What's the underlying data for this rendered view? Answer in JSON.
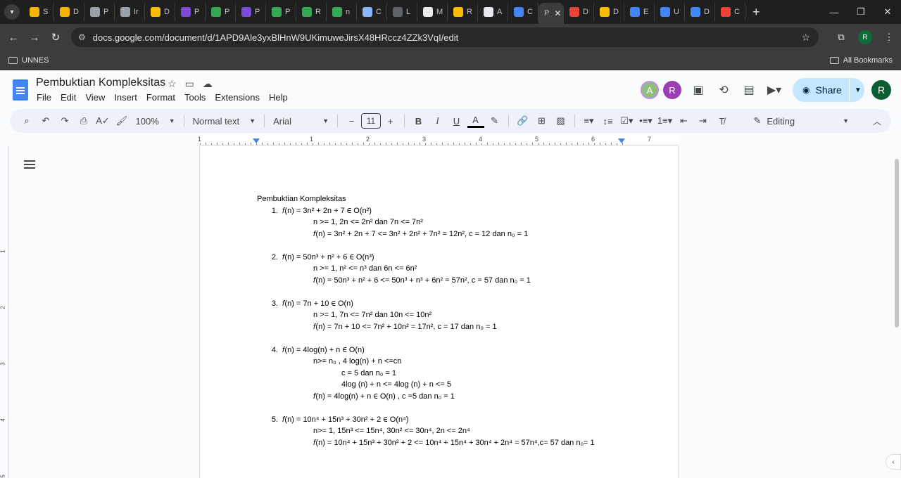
{
  "browser": {
    "tabs": [
      {
        "label": "S",
        "color": "#f4b400"
      },
      {
        "label": "D",
        "color": "#f4b400"
      },
      {
        "label": "P",
        "color": "#9aa0a6"
      },
      {
        "label": "Ir",
        "color": "#9aa0a6"
      },
      {
        "label": "D",
        "color": "#fbbc04"
      },
      {
        "label": "P",
        "color": "#7b4ad6"
      },
      {
        "label": "P",
        "color": "#34a853"
      },
      {
        "label": "P",
        "color": "#7b4ad6"
      },
      {
        "label": "P",
        "color": "#34a853"
      },
      {
        "label": "R",
        "color": "#34a853"
      },
      {
        "label": "n",
        "color": "#34a853"
      },
      {
        "label": "C",
        "color": "#8ab4f8"
      },
      {
        "label": "L",
        "color": "#5f6368"
      },
      {
        "label": "M",
        "color": "#e8eaed"
      },
      {
        "label": "R",
        "color": "#fbbc04"
      },
      {
        "label": "A",
        "color": "#e8eaed"
      },
      {
        "label": "C",
        "color": "#4285f4"
      },
      {
        "label": "P",
        "color": "#3c3c3c",
        "active": true
      },
      {
        "label": "D",
        "color": "#ea4335"
      },
      {
        "label": "D",
        "color": "#fbbc04"
      },
      {
        "label": "E",
        "color": "#4285f4"
      },
      {
        "label": "U",
        "color": "#4285f4"
      },
      {
        "label": "D",
        "color": "#4285f4"
      },
      {
        "label": "C",
        "color": "#ea4335"
      }
    ],
    "url": "docs.google.com/document/d/1APD9Ale3yxBlHnW9UKimuweJirsX48HRccz4ZZk3VqI/edit",
    "bookmark_folder": "UNNES",
    "all_bookmarks": "All Bookmarks",
    "profile_initial": "R"
  },
  "docs": {
    "title": "Pembuktian Kompleksitas",
    "menu": [
      "File",
      "Edit",
      "View",
      "Insert",
      "Format",
      "Tools",
      "Extensions",
      "Help"
    ],
    "avatars": [
      "A",
      "R"
    ],
    "share_label": "Share",
    "user_initial": "R",
    "toolbar": {
      "zoom": "100%",
      "style": "Normal text",
      "font": "Arial",
      "font_size": "11",
      "mode": "Editing"
    },
    "ruler_numbers": [
      "1",
      "1",
      "2",
      "3",
      "4",
      "5",
      "6",
      "7"
    ],
    "vruler_numbers": [
      "1",
      "2",
      "3",
      "4",
      "5"
    ]
  },
  "document": {
    "heading": "Pembuktian Kompleksitas",
    "items": [
      {
        "num": "1.",
        "main": "𝑓(n) = 3n² + 2n + 7 ∈ O(n²)",
        "lines": [
          {
            "indent": 1,
            "text": "n >= 1, 2n <= 2n² dan 7n <= 7n²"
          },
          {
            "indent": 1,
            "text": "𝑓(n) = 3n² + 2n + 7 <= 3n² + 2n² + 7n² = 12n², c = 12 dan n₀ = 1"
          }
        ]
      },
      {
        "num": "2.",
        "main": "𝑓(n) = 50n³ + n² + 6 ∈ O(n³)",
        "lines": [
          {
            "indent": 1,
            "text": "n >= 1, n² <= n³ dan 6n <= 6n²"
          },
          {
            "indent": 1,
            "text": "𝑓(n) = 50n³ + n² + 6 <= 50n³ + n³ + 6n² = 57n², c = 57 dan n₀ = 1"
          }
        ]
      },
      {
        "num": "3.",
        "main": "𝑓(n) = 7n + 10 ∈ O(n)",
        "lines": [
          {
            "indent": 1,
            "text": "n >= 1, 7n <= 7n² dan 10n <= 10n²"
          },
          {
            "indent": 1,
            "text": "𝑓(n) = 7n + 10 <= 7n² + 10n² = 17n², c = 17 dan n₀ = 1"
          }
        ]
      },
      {
        "num": "4.",
        "main": "𝑓(n) = 4log(n) + n ∈ O(n)",
        "lines": [
          {
            "indent": 1,
            "text": "n>= n₀ , 4 log(n) + n <=cn"
          },
          {
            "indent": 2,
            "text": "c = 5 dan n₀ = 1"
          },
          {
            "indent": 2,
            "text": "4log (n) + n <= 4log (n) + n <= 5"
          },
          {
            "indent": 1,
            "text": "𝑓(n) = 4log(n) + n ∈ O(n) , c =5 dan n₀ = 1"
          }
        ]
      },
      {
        "num": "5.",
        "main": "𝑓(n) = 10n⁴ + 15n³ + 30n² + 2 ∈ O(n⁴)",
        "lines": [
          {
            "indent": 1,
            "text": "n>= 1, 15n³ <= 15n⁴, 30n² <= 30n⁴, 2n <= 2n⁴"
          },
          {
            "indent": 1,
            "text": "𝑓(n) = 10n⁴ + 15n³ + 30n² + 2 <= 10n⁴ + 15n⁴ + 30n⁴ + 2n⁴ = 57n⁴,c= 57 dan n₀= 1"
          }
        ]
      }
    ]
  }
}
